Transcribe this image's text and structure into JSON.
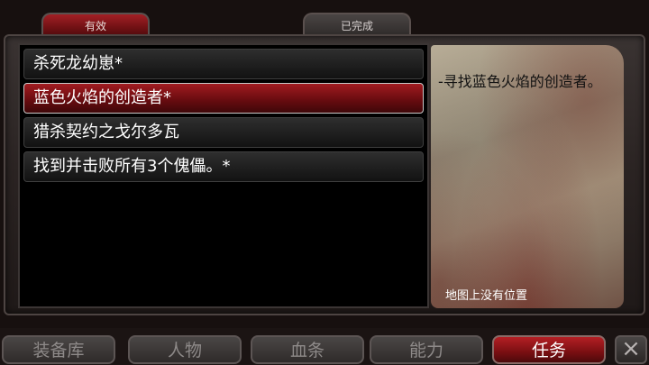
{
  "tabs": {
    "active": "有效",
    "completed": "已完成"
  },
  "quests": [
    {
      "title": "杀死龙幼崽*",
      "selected": false
    },
    {
      "title": "蓝色火焰的创造者*",
      "selected": true
    },
    {
      "title": "猎杀契约之戈尔多瓦",
      "selected": false
    },
    {
      "title": "找到并击败所有3个傀儡。*",
      "selected": false
    }
  ],
  "detail": {
    "description": "-寻找蓝色火焰的创造者。",
    "location": "地图上没有位置"
  },
  "nav": {
    "inventory": "装备库",
    "character": "人物",
    "bloodline": "血条",
    "ability": "能力",
    "quests": "任务",
    "active_item": "quests"
  },
  "close_icon": "×",
  "colors": {
    "accent_red": "#a11b20",
    "parchment": "#a59a83"
  }
}
